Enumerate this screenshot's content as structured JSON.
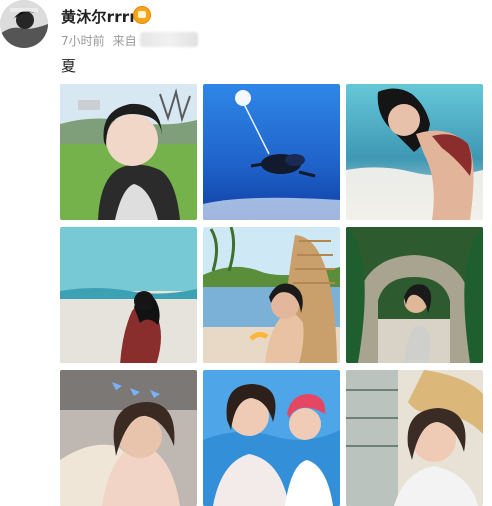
{
  "post": {
    "username": "黄沐尔rrrr",
    "timestamp": "7小时前",
    "source_label": "来自",
    "text": "夏"
  },
  "icons": {
    "avatar": "profile-avatar",
    "vip": "vip-badge-icon"
  },
  "images": [
    {
      "label": "selfie-grass-field"
    },
    {
      "label": "skydiving-parachute"
    },
    {
      "label": "beach-hair-photo"
    },
    {
      "label": "beach-back-view"
    },
    {
      "label": "pool-wicker-chair"
    },
    {
      "label": "garden-archway"
    },
    {
      "label": "indoor-portrait"
    },
    {
      "label": "blue-sky-friends"
    },
    {
      "label": "window-portrait"
    }
  ],
  "colors": {
    "username": "#222222",
    "meta": "#999999",
    "vip": "#f6a41a"
  }
}
